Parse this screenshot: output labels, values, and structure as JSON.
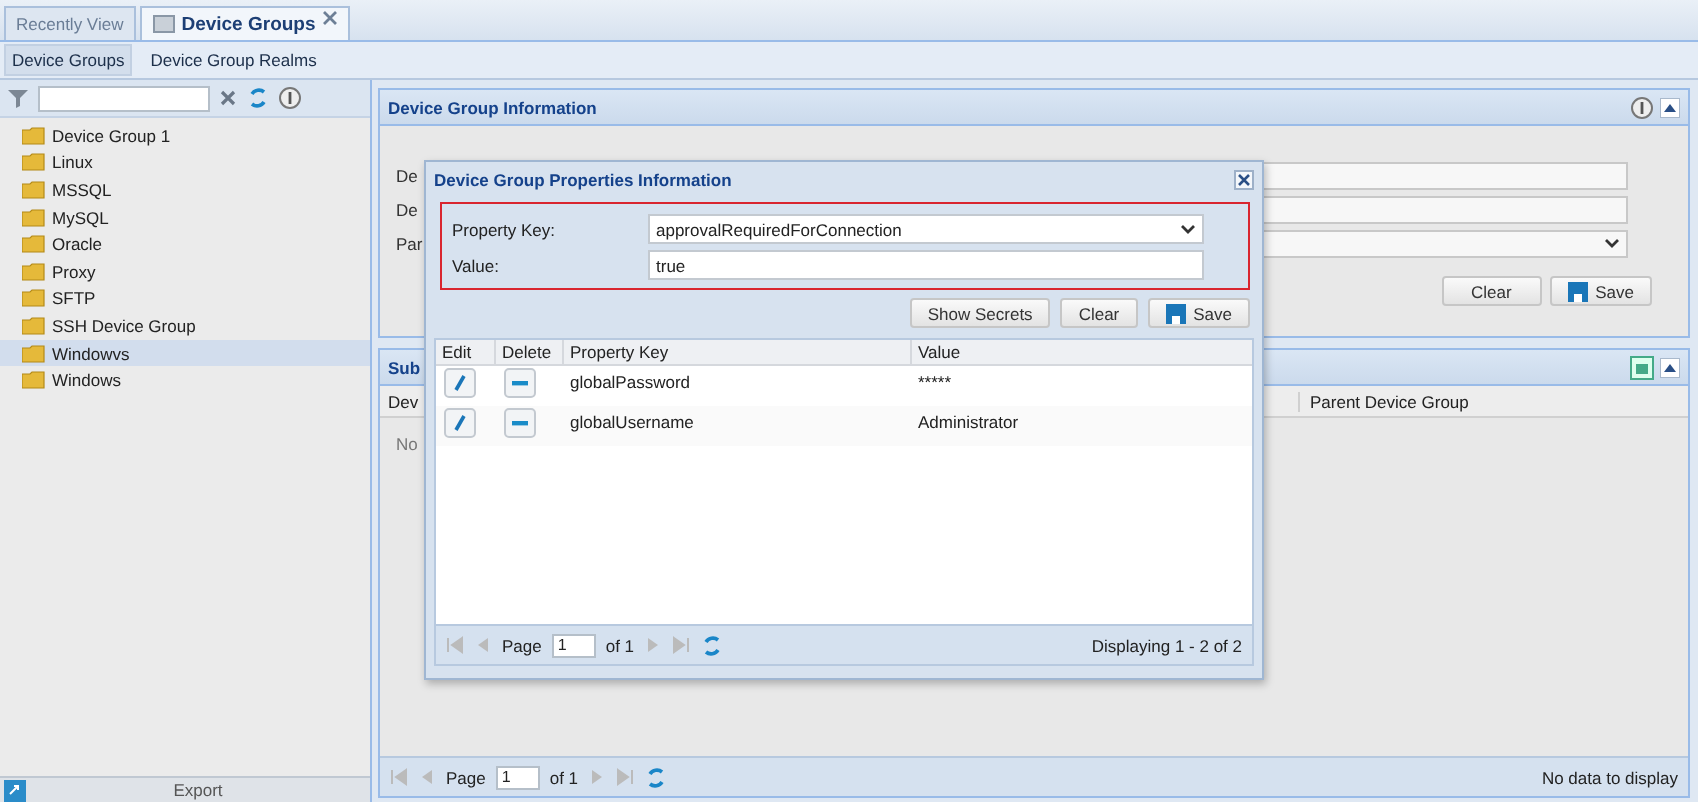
{
  "tabs": [
    {
      "label": "Recently View",
      "selected": false,
      "closable": false
    },
    {
      "label": "Device Groups",
      "selected": true,
      "closable": true
    }
  ],
  "subtabs": [
    {
      "label": "Device Groups",
      "selected": true
    },
    {
      "label": "Device Group Realms",
      "selected": false
    }
  ],
  "tree": {
    "items": [
      {
        "label": "Device Group 1",
        "selected": false
      },
      {
        "label": "Linux",
        "selected": false
      },
      {
        "label": "MSSQL",
        "selected": false
      },
      {
        "label": "MySQL",
        "selected": false
      },
      {
        "label": "Oracle",
        "selected": false
      },
      {
        "label": "Proxy",
        "selected": false
      },
      {
        "label": "SFTP",
        "selected": false
      },
      {
        "label": "SSH Device Group",
        "selected": false
      },
      {
        "label": "Windowvs",
        "selected": true
      },
      {
        "label": "Windows",
        "selected": false
      }
    ],
    "export": "Export"
  },
  "info_panel": {
    "title": "Device Group Information",
    "fields": [
      {
        "label": "De",
        "kind": "text"
      },
      {
        "label": "De",
        "kind": "text"
      },
      {
        "label": "Par",
        "kind": "combo"
      }
    ],
    "buttons": [
      {
        "label": "Clear",
        "kind": "plain"
      },
      {
        "label": "Save",
        "kind": "save"
      }
    ]
  },
  "sub_panel": {
    "title": "Sub",
    "columns": [
      "Dev",
      "Parent Device Group"
    ],
    "empty": "No",
    "pager": {
      "page_label": "Page",
      "page": "1",
      "of": "of 1",
      "status": "No data to display"
    }
  },
  "dialog": {
    "title": "Device Group Properties Information",
    "fields": [
      {
        "label": "Property Key:",
        "value": "approvalRequiredForConnection",
        "kind": "combo"
      },
      {
        "label": "Value:",
        "value": "true",
        "kind": "text"
      }
    ],
    "buttons": [
      {
        "label": "Show Secrets",
        "kind": "plain"
      },
      {
        "label": "Clear",
        "kind": "plain"
      },
      {
        "label": "Save",
        "kind": "save"
      }
    ],
    "columns": [
      "Edit",
      "Delete",
      "Property Key",
      "Value"
    ],
    "rows": [
      {
        "key": "globalPassword",
        "value": "*****"
      },
      {
        "key": "globalUsername",
        "value": "Administrator"
      }
    ],
    "pager": {
      "page_label": "Page",
      "page": "1",
      "of": "of 1",
      "status": "Displaying 1 - 2 of 2"
    }
  }
}
